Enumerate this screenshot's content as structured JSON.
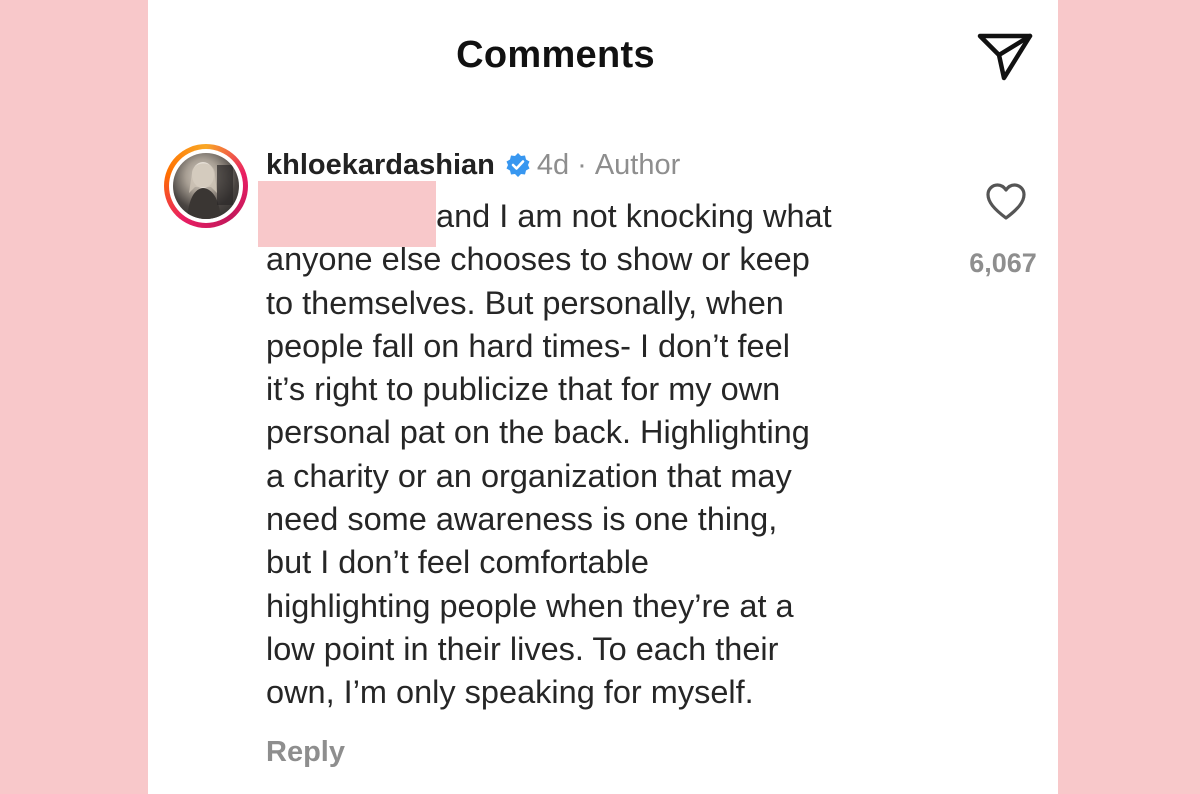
{
  "header": {
    "title": "Comments",
    "share_icon": "paper-plane-icon"
  },
  "comment": {
    "username": "khloekardashian",
    "verified_icon": "verified-badge-icon",
    "time": "4d",
    "separator": "·",
    "badge": "Author",
    "lines": [
      "and I am not knocking what",
      "anyone else chooses to show or keep",
      "to themselves. But personally, when",
      "people fall on hard times- I don’t feel",
      "it’s right to publicize that for my own",
      "personal pat on the back. Highlighting",
      "a charity or an organization that may",
      "need some awareness is one thing,",
      "but I don’t feel comfortable",
      "highlighting people when they’re at a",
      "low point in their lives. To each their",
      "own, I’m only speaking for myself."
    ],
    "like_icon": "heart-outline-icon",
    "like_count": "6,067",
    "reply_label": "Reply"
  },
  "colors": {
    "background": "#f8c8ca",
    "panel": "#ffffff",
    "text_primary": "#262626",
    "text_secondary": "#8e8e8e",
    "verified": "#3897f0",
    "redaction": "#f8c8ca"
  }
}
